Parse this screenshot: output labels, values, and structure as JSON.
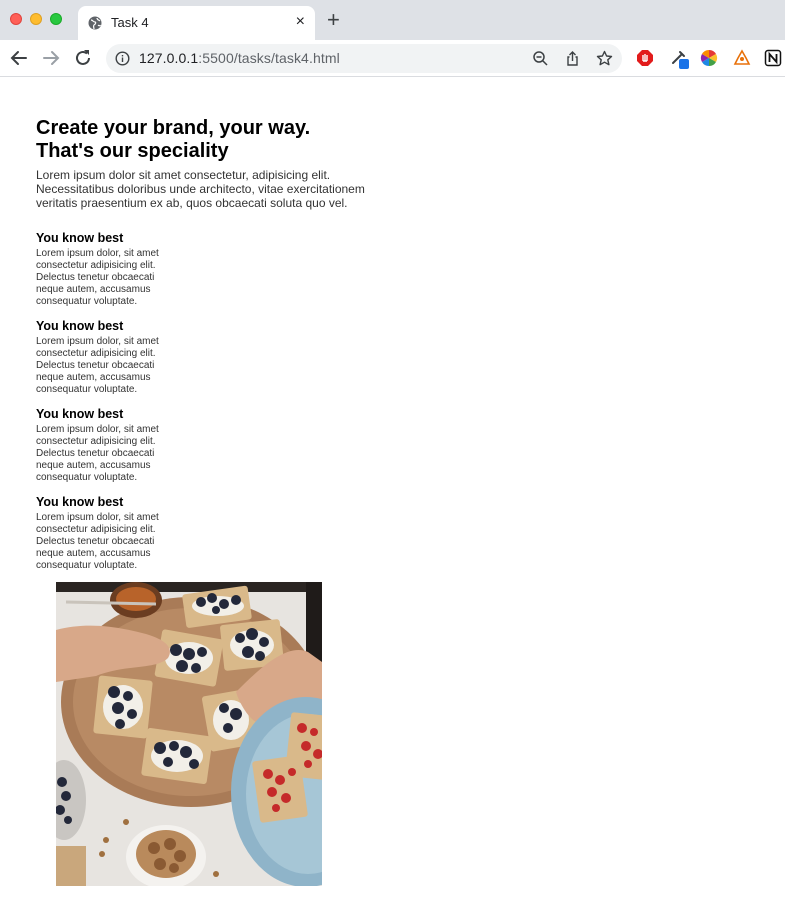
{
  "browser": {
    "tab_title": "Task 4",
    "close_glyph": "×",
    "new_tab_glyph": "+",
    "url_host": "127.0.0.1",
    "url_rest": ":5500/tasks/task4.html"
  },
  "page": {
    "headline_line1": "Create your brand, your way.",
    "headline_line2": "That's our speciality",
    "intro": "Lorem ipsum dolor sit amet consectetur, adipisicing elit. Necessitatibus doloribus unde architecto, vitae exercitationem veritatis praesentium ex ab, quos obcaecati soluta quo vel.",
    "features": [
      {
        "title": "You know best",
        "text": "Lorem ipsum dolor, sit amet consectetur adipisicing elit. Delectus tenetur obcaecati neque autem, accusamus consequatur voluptate."
      },
      {
        "title": "You know best",
        "text": "Lorem ipsum dolor, sit amet consectetur adipisicing elit. Delectus tenetur obcaecati neque autem, accusamus consequatur voluptate."
      },
      {
        "title": "You know best",
        "text": "Lorem ipsum dolor, sit amet consectetur adipisicing elit. Delectus tenetur obcaecati neque autem, accusamus consequatur voluptate."
      },
      {
        "title": "You know best",
        "text": "Lorem ipsum dolor, sit amet consectetur adipisicing elit. Delectus tenetur obcaecati neque autem, accusamus consequatur voluptate."
      }
    ]
  },
  "icons": {
    "tab_favicon": "globe-icon",
    "back": "arrow-left-icon",
    "forward": "arrow-right-icon",
    "reload": "reload-icon",
    "site_info": "info-icon",
    "zoom": "zoom-out-icon",
    "share": "share-icon",
    "bookmark": "star-icon",
    "extensions": [
      "adblock-icon",
      "eyedropper-icon",
      "color-wheel-icon",
      "extension-icon",
      "notion-icon"
    ]
  },
  "colors": {
    "tabbar_bg": "#dee1e6",
    "omnibox_bg": "#f1f3f4"
  }
}
